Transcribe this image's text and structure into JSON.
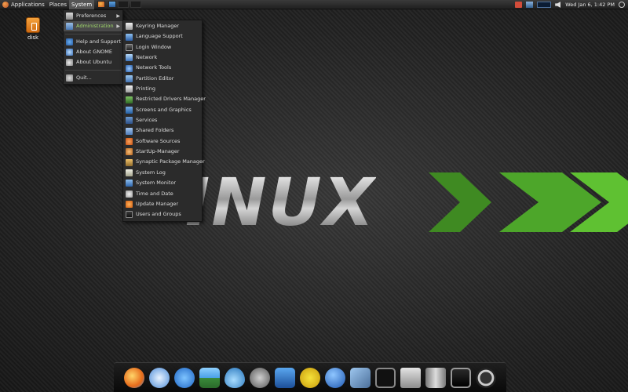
{
  "top_panel": {
    "menus": [
      "Applications",
      "Places",
      "System"
    ],
    "clock": "Wed Jan 6,  1:42 PM"
  },
  "desktop": {
    "icons": [
      {
        "label": "disk",
        "icon": "drive-icon"
      }
    ]
  },
  "logo": {
    "text": "INUX"
  },
  "system_menu": {
    "items": [
      {
        "label": "Preferences",
        "icon": "preferences-icon",
        "submenu": true
      },
      {
        "label": "Administration",
        "icon": "administration-icon",
        "submenu": true,
        "active": true
      },
      {
        "label": "Help and Support",
        "icon": "help-icon"
      },
      {
        "label": "About GNOME",
        "icon": "gnome-icon"
      },
      {
        "label": "About Ubuntu",
        "icon": "ubuntu-icon"
      },
      {
        "label": "Quit...",
        "icon": "quit-icon"
      }
    ]
  },
  "admin_menu": {
    "items": [
      {
        "label": "Keyring Manager",
        "icon": "keyring-icon"
      },
      {
        "label": "Language Support",
        "icon": "language-icon"
      },
      {
        "label": "Login Window",
        "icon": "login-window-icon"
      },
      {
        "label": "Network",
        "icon": "network-icon"
      },
      {
        "label": "Network Tools",
        "icon": "network-tools-icon"
      },
      {
        "label": "Partition Editor",
        "icon": "partition-editor-icon"
      },
      {
        "label": "Printing",
        "icon": "printer-icon"
      },
      {
        "label": "Restricted Drivers Manager",
        "icon": "chip-icon"
      },
      {
        "label": "Screens and Graphics",
        "icon": "display-icon"
      },
      {
        "label": "Services",
        "icon": "services-icon"
      },
      {
        "label": "Shared Folders",
        "icon": "shared-folder-icon"
      },
      {
        "label": "Software Sources",
        "icon": "software-sources-icon"
      },
      {
        "label": "StartUp-Manager",
        "icon": "startup-icon"
      },
      {
        "label": "Synaptic Package Manager",
        "icon": "synaptic-icon"
      },
      {
        "label": "System Log",
        "icon": "log-icon"
      },
      {
        "label": "System Monitor",
        "icon": "monitor-icon"
      },
      {
        "label": "Time and Date",
        "icon": "clock-icon"
      },
      {
        "label": "Update Manager",
        "icon": "update-icon"
      },
      {
        "label": "Users and Groups",
        "icon": "users-icon"
      }
    ]
  },
  "dock": {
    "icons": [
      "xchat-icon",
      "music-player-icon",
      "chat-icon",
      "photo-viewer-icon",
      "water-drop-icon",
      "tools-icon",
      "web-editor-icon",
      "radiation-icon",
      "help-icon",
      "image-viewer-icon",
      "terminal-icon",
      "calculator-icon",
      "trash-icon",
      "screen-icon",
      "power-icon"
    ]
  },
  "colors": {
    "accent_green": "#5fb13a",
    "menu_bg": "#2b2b2b",
    "active_text": "#9fd86a"
  }
}
